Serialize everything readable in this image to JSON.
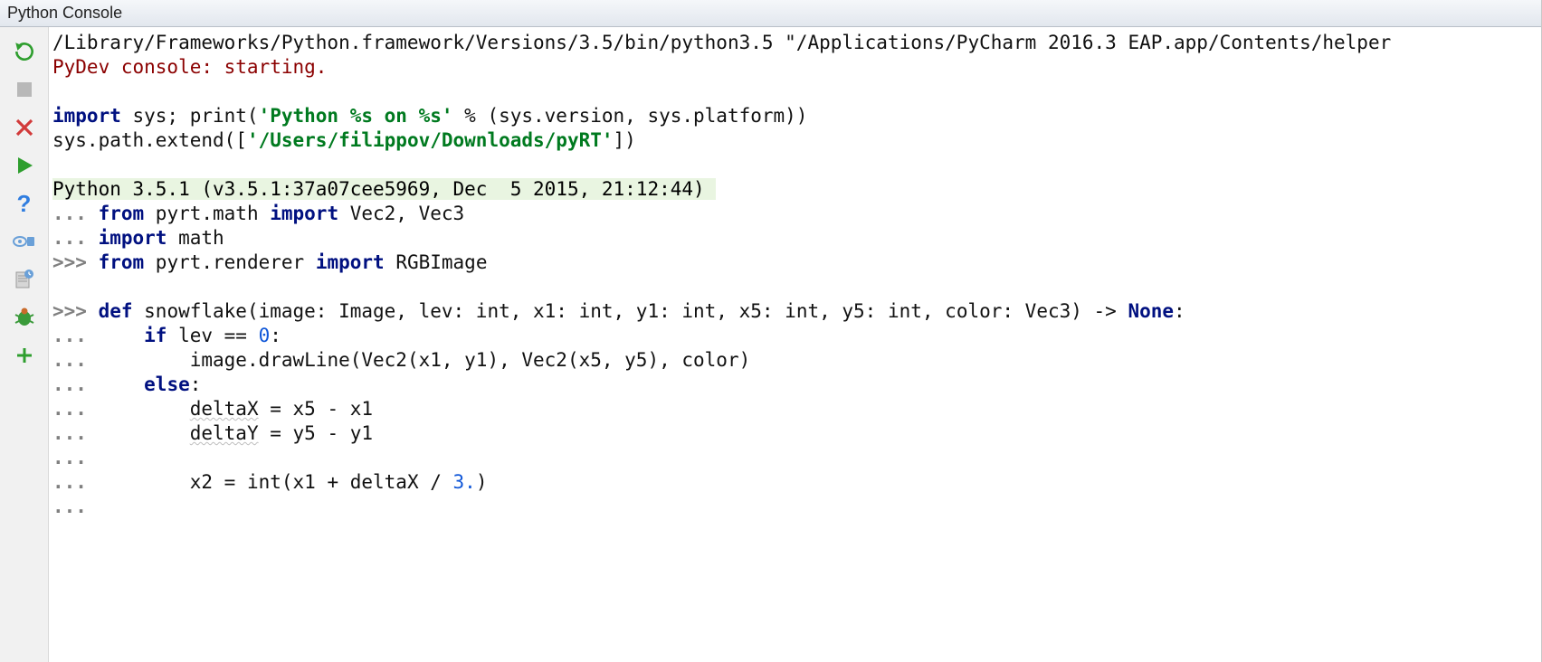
{
  "title": "Python Console",
  "toolbar": {
    "rerun": "rerun-icon",
    "stop": "stop-icon",
    "close": "close-icon",
    "run": "run-icon",
    "help": "help-icon",
    "vars": "variables-icon",
    "history": "history-icon",
    "debug": "debug-icon",
    "add": "add-icon"
  },
  "lines": {
    "path": "/Library/Frameworks/Python.framework/Versions/3.5/bin/python3.5 \"/Applications/PyCharm 2016.3 EAP.app/Contents/helper",
    "pydev": "PyDev console: starting.",
    "import1a": "import",
    "import1b": " sys; print(",
    "import1c": "'Python %s on %s'",
    "import1d": " % (sys.version, sys.platform))",
    "import2a": "sys.path.extend([",
    "import2b": "'/Users/filippov/Downloads/pyRT'",
    "import2c": "])",
    "version": "Python 3.5.1 (v3.5.1:37a07cee5969, Dec  5 2015, 21:12:44) ",
    "l1_dots": "... ",
    "l1_from": "from",
    "l1_mid": " pyrt.math ",
    "l1_imp": "import",
    "l1_end": " Vec2, Vec3",
    "l2_dots": "... ",
    "l2_imp": "import",
    "l2_end": " math",
    "l3_pr": ">>> ",
    "l3_from": "from",
    "l3_mid": " pyrt.renderer ",
    "l3_imp": "import",
    "l3_end": " RGBImage",
    "blank": "",
    "l4_pr": ">>> ",
    "l4_def": "def",
    "l4_sig1": " snowflake(image: Image, lev: int, x1: int, y1: int, x5: int, y5: int, color: Vec3) -> ",
    "l4_none": "None",
    "l4_colon": ":",
    "l5_dots": "... ",
    "l5_pad": "    ",
    "l5_if": "if",
    "l5_cond": " lev == ",
    "l5_zero": "0",
    "l5_colon": ":",
    "l6_dots": "... ",
    "l6_body": "        image.drawLine(Vec2(x1, y1), Vec2(x5, y5), color)",
    "l7_dots": "... ",
    "l7_pad": "    ",
    "l7_else": "else",
    "l7_colon": ":",
    "l8_dots": "... ",
    "l8_pad": "        ",
    "l8_var": "deltaX",
    "l8_expr": " = x5 - x1",
    "l9_dots": "... ",
    "l9_pad": "        ",
    "l9_var": "deltaY",
    "l9_expr": " = y5 - y1",
    "l10_dots": "... ",
    "l11_dots": "... ",
    "l11_body1": "        x2 = int(x1 + deltaX / ",
    "l11_num": "3.",
    "l11_body2": ")",
    "l12_dots": "... "
  }
}
